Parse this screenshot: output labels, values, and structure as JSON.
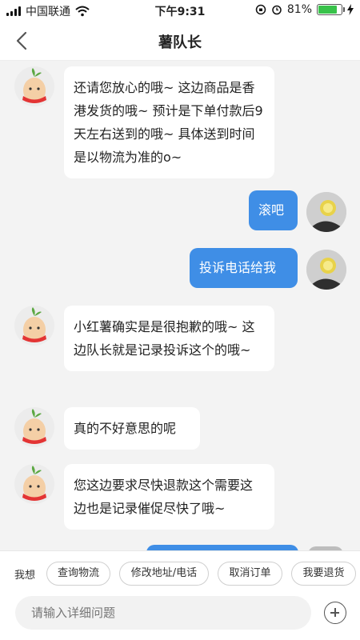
{
  "status_bar": {
    "carrier": "中国联通",
    "time": "下午9:31",
    "battery": "81%",
    "battery_level": 0.81
  },
  "header": {
    "title": "薯队长",
    "back_icon": "chevron-left-icon"
  },
  "messages": [
    {
      "side": "in",
      "text": "还请您放心的哦~ 这边商品是香港发货的哦~ 预计是下单付款后9天左右送到的哦~ 具体送到时间是以物流为准的o~"
    },
    {
      "side": "out",
      "text": "滚吧"
    },
    {
      "side": "out",
      "text": "投诉电话给我"
    },
    {
      "side": "in",
      "text": "小红薯确实是是很抱歉的哦~ 这边队长就是记录投诉这个的哦~"
    },
    {
      "side": "in",
      "text": "真的不好意思的呢"
    },
    {
      "side": "in",
      "text": "您这边要求尽快退款这个需要这边也是记录催促尽快了哦~"
    }
  ],
  "quick_bar": {
    "label": "我想",
    "chips": [
      "查询物流",
      "修改地址/电话",
      "取消订单",
      "我要退货"
    ]
  },
  "input": {
    "placeholder": "请输入详细问题"
  },
  "colors": {
    "accent": "#3f8ee6",
    "bubble_in": "#ffffff",
    "background": "#f3f3f3",
    "battery": "#38c24a"
  }
}
